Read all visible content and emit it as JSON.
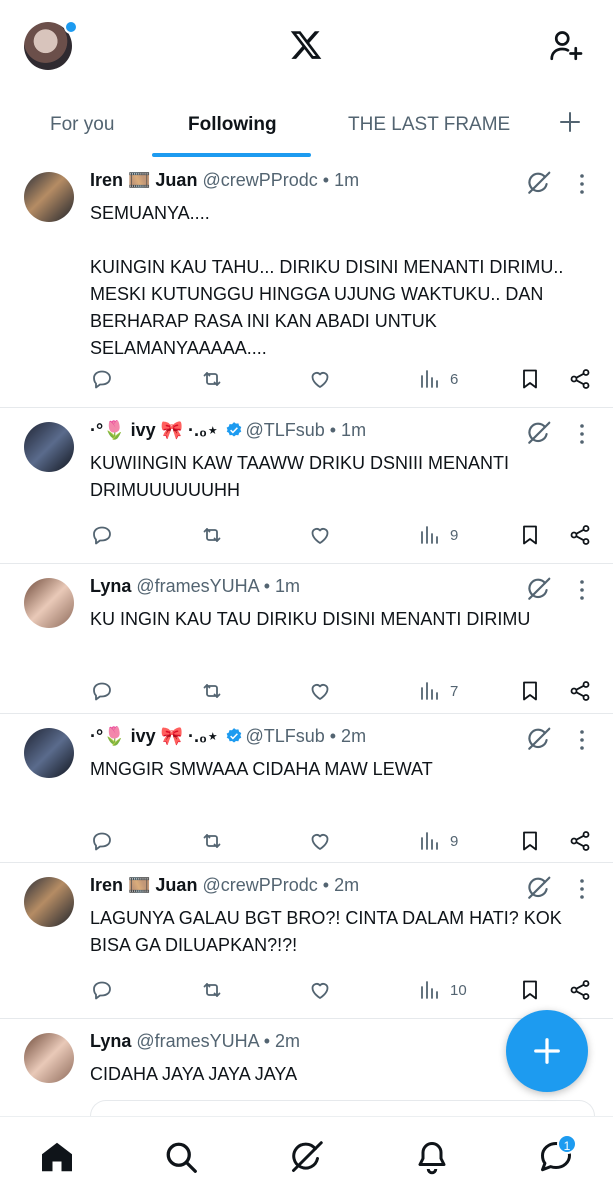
{
  "header": {
    "logo": "x-logo",
    "tabs": [
      {
        "label": "For you",
        "active": false
      },
      {
        "label": "Following",
        "active": true
      },
      {
        "label": "THE LAST FRAME",
        "active": false
      }
    ],
    "accent": "#1d9bf0"
  },
  "tweets": [
    {
      "name": "Iren 🎞️ Juan",
      "handle": "@crewPProdc",
      "time": "• 1m",
      "verified": false,
      "text": "SEMUANYA....\n\nKUINGIN KAU TAHU... DIRIKU DISINI MENANTI DIRIMU.. MESKI KUTUNGGU HINGGA UJUNG WAKTUKU.. DAN BERHARAP RASA INI KAN ABADI UNTUK SELAMANYAAAAA....",
      "views": "6"
    },
    {
      "name": "·°🌷 ivy 🎀 ·.₀⋆",
      "handle": "@TLFsub",
      "time": "• 1m",
      "verified": true,
      "text": "KUWIINGIN KAW TAAWW DRIKU DSNIII MENANTI DRIMUUUUUUHH",
      "views": "9"
    },
    {
      "name": "Lyna",
      "handle": "@framesYUHA",
      "time": "• 1m",
      "verified": false,
      "text": "KU INGIN KAU TAU DIRIKU DISINI MENANTI DIRIMU",
      "views": "7"
    },
    {
      "name": "·°🌷 ivy 🎀 ·.₀⋆",
      "handle": "@TLFsub",
      "time": "• 2m",
      "verified": true,
      "text": "MNGGIR SMWAAA CIDAHA MAW LEWAT",
      "views": "9"
    },
    {
      "name": "Iren 🎞️ Juan",
      "handle": "@crewPProdc",
      "time": "• 2m",
      "verified": false,
      "text": "LAGUNYA GALAU BGT BRO?! CINTA DALAM HATI? KOK BISA GA DILUAPKAN?!?!",
      "views": "10"
    },
    {
      "name": "Lyna",
      "handle": "@framesYUHA",
      "time": "• 2m",
      "verified": false,
      "text": "CIDAHA JAYA JAYA JAYA",
      "views": ""
    }
  ],
  "bottomnav": {
    "items": [
      "home-icon",
      "search-icon",
      "grok-icon",
      "notifications-icon",
      "messages-icon"
    ],
    "messages_badge": "1"
  }
}
